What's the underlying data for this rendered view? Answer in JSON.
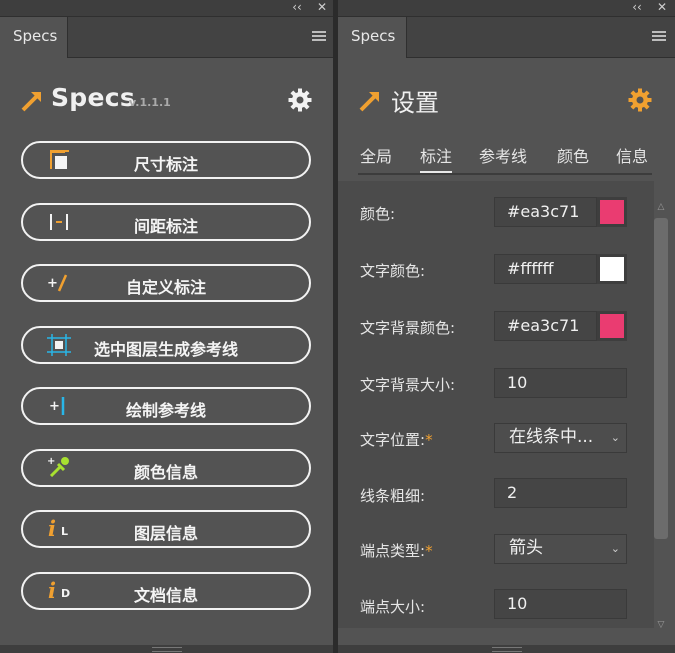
{
  "left_panel": {
    "tab_label": "Specs",
    "collapse_glyph": "‹‹",
    "close_glyph": "✕",
    "logo_text": "Specs",
    "version": "v.1.1.1",
    "buttons": [
      {
        "label": "尺寸标注",
        "icon": "dimension-icon"
      },
      {
        "label": "间距标注",
        "icon": "spacing-icon"
      },
      {
        "label": "自定义标注",
        "icon": "custom-annotation-icon"
      },
      {
        "label": "选中图层生成参考线",
        "icon": "layer-guide-icon"
      },
      {
        "label": "绘制参考线",
        "icon": "draw-guide-icon"
      },
      {
        "label": "颜色信息",
        "icon": "eyedropper-icon"
      },
      {
        "label": "图层信息",
        "icon": "layer-info-icon"
      },
      {
        "label": "文档信息",
        "icon": "document-info-icon"
      }
    ],
    "icon_letters": {
      "layer": "L",
      "document": "D",
      "info": "i",
      "plus": "+"
    }
  },
  "right_panel": {
    "tab_label": "Specs",
    "collapse_glyph": "‹‹",
    "close_glyph": "✕",
    "title": "设置",
    "tabs": [
      "全局",
      "标注",
      "参考线",
      "颜色",
      "信息"
    ],
    "active_tab": "标注",
    "fields": {
      "color_label": "颜色:",
      "color_value": "#ea3c71",
      "text_color_label": "文字颜色:",
      "text_color_value": "#ffffff",
      "text_bg_color_label": "文字背景颜色:",
      "text_bg_color_value": "#ea3c71",
      "text_bg_size_label": "文字背景大小:",
      "text_bg_size_value": "10",
      "text_position_label": "文字位置:",
      "text_position_value": "在线条中...",
      "line_width_label": "线条粗细:",
      "line_width_value": "2",
      "endpoint_type_label": "端点类型:",
      "endpoint_type_value": "箭头",
      "endpoint_size_label": "端点大小:",
      "endpoint_size_value": "10",
      "required_mark": "*"
    }
  },
  "colors": {
    "accent": "#f0a030",
    "swatch_color": "#ea3c71",
    "swatch_text_color": "#ffffff",
    "swatch_bg_color": "#ea3c71",
    "panel_bg": "#535353",
    "cyan_icon": "#29b6e8"
  }
}
